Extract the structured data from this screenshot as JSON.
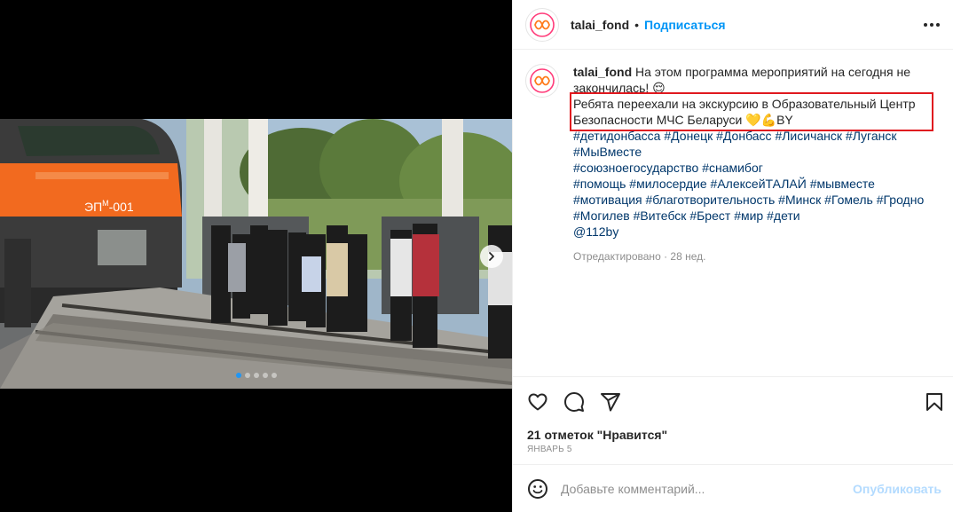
{
  "post": {
    "username": "talai_fond",
    "separator": "•",
    "follow_label": "Подписаться",
    "more_icon": "more-horizontal-icon"
  },
  "photo": {
    "train_label": "ЭП",
    "train_label_sup": "М",
    "train_label_num": "-001",
    "carousel_dots": 5,
    "active_dot": 0
  },
  "caption": {
    "username": "talai_fond",
    "line1": "На этом программа мероприятий на сегодня не закончилась! 😌",
    "highlighted": "Ребята переехали на экскурсию в Образовательный Центр Безопасности МЧС Беларуси 💛💪BY",
    "hashtags_1": [
      "#детидонбасса",
      "#Донецк",
      "#Донбасс",
      "#Лисичанск",
      "#Луганск",
      "#МыВместе"
    ],
    "hashtags_2": [
      "#союзноегосударство",
      "#снамибог"
    ],
    "hashtags_3": [
      "#помощь",
      "#милосердие",
      "#АлексейТАЛАЙ",
      "#мывместе",
      "#мотивация",
      "#благотворительность",
      "#Минск",
      "#Гомель",
      "#Гродно",
      "#Могилев",
      "#Витебск",
      "#Брест",
      "#мир",
      "#дети"
    ],
    "mention": "@112by",
    "meta": "Отредактировано · 28 нед."
  },
  "actions": {
    "likes": "21 отметок \"Нравится\"",
    "date": "ЯНВАРЬ 5"
  },
  "comment_box": {
    "placeholder": "Добавьте комментарий...",
    "publish_label": "Опубликовать"
  },
  "colors": {
    "link_blue": "#0095f6",
    "hashtag": "#00376b",
    "highlight_border": "#e0191f",
    "publish_disabled": "#b3dbff"
  }
}
